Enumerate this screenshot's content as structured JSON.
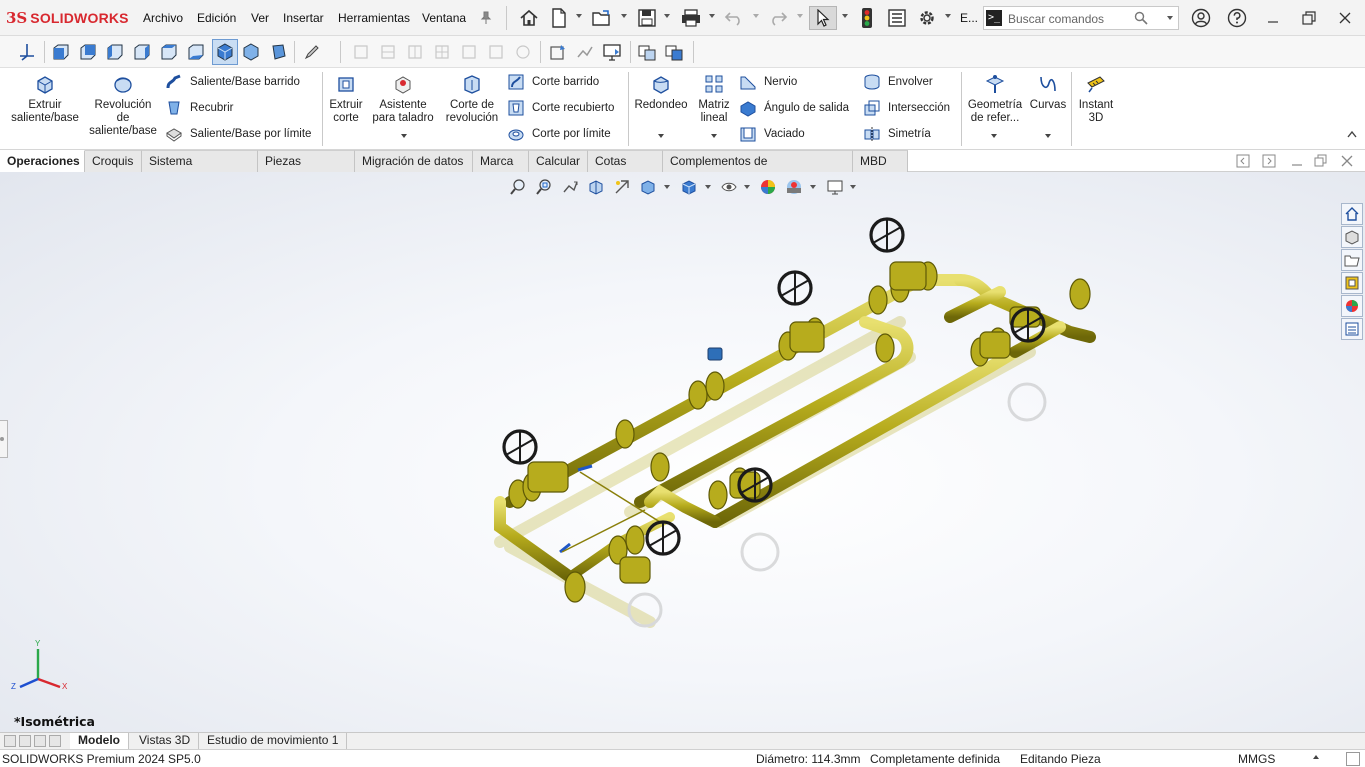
{
  "app": {
    "logo_ds": "3S",
    "logo_name": "SOLIDWORKS"
  },
  "menu": [
    "Archivo",
    "Edición",
    "Ver",
    "Insertar",
    "Herramientas",
    "Ventana"
  ],
  "title_extra": "E...",
  "search": {
    "placeholder": "Buscar comandos"
  },
  "commands": {
    "extrude_boss": "Extruir saliente/base",
    "revolve_boss": "Revolución de saliente/base",
    "swept_boss": "Saliente/Base barrido",
    "loft_boss": "Recubrir",
    "boundary_boss": "Saliente/Base por límite",
    "extrude_cut": "Extruir corte",
    "hole_wizard": "Asistente para taladro",
    "revolve_cut": "Corte de revolución",
    "swept_cut": "Corte barrido",
    "loft_cut": "Corte recubierto",
    "boundary_cut": "Corte por límite",
    "fillet": "Redondeo",
    "linear_pattern": "Matriz lineal",
    "rib": "Nervio",
    "draft": "Ángulo de salida",
    "shell": "Vaciado",
    "wrap": "Envolver",
    "intersect": "Intersección",
    "mirror": "Simetría",
    "ref_geometry": "Geometría de refer...",
    "curves": "Curvas",
    "instant3d": "Instant 3D"
  },
  "tabs": [
    "Operaciones",
    "Croquis",
    "Sistema estructural",
    "Piezas soldadas",
    "Migración de datos",
    "Marca",
    "Calcular",
    "Cotas MBD",
    "Complementos de SOLIDWORKS",
    "MBD"
  ],
  "active_tab": "Operaciones",
  "viewport": {
    "view_name": "*Isométrica",
    "triad": {
      "x": "X",
      "y": "Y",
      "z": "Z"
    }
  },
  "bottom_tabs": [
    "Modelo",
    "Vistas 3D",
    "Estudio de movimiento 1"
  ],
  "status": {
    "product": "SOLIDWORKS Premium 2024 SP5.0",
    "measure": "Diámetro: 114.3mm",
    "definition": "Completamente definida",
    "mode": "Editando Pieza",
    "units": "MMGS"
  },
  "colors": {
    "brand_red": "#d8282f",
    "pipe": "#a8a214",
    "wheel": "#222222"
  }
}
